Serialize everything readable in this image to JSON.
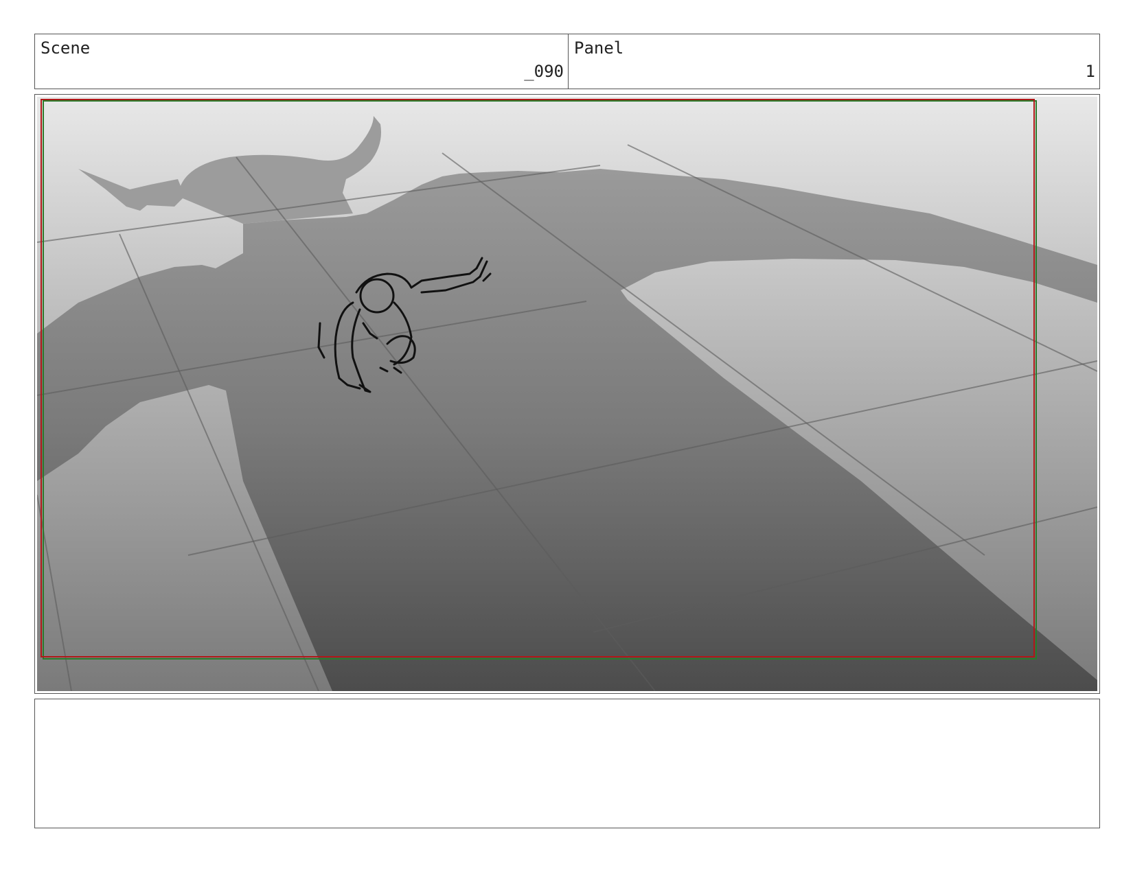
{
  "header": {
    "scene_label": "Scene",
    "scene_value": "_090",
    "panel_label": "Panel",
    "panel_value": "1"
  },
  "panel_image": {
    "description_icon": "storyboard-sketch"
  },
  "notes": {
    "text": ""
  },
  "colors": {
    "safe_frame_red": "#b01818",
    "safe_frame_green": "#2a7a2a",
    "border": "#555555"
  }
}
